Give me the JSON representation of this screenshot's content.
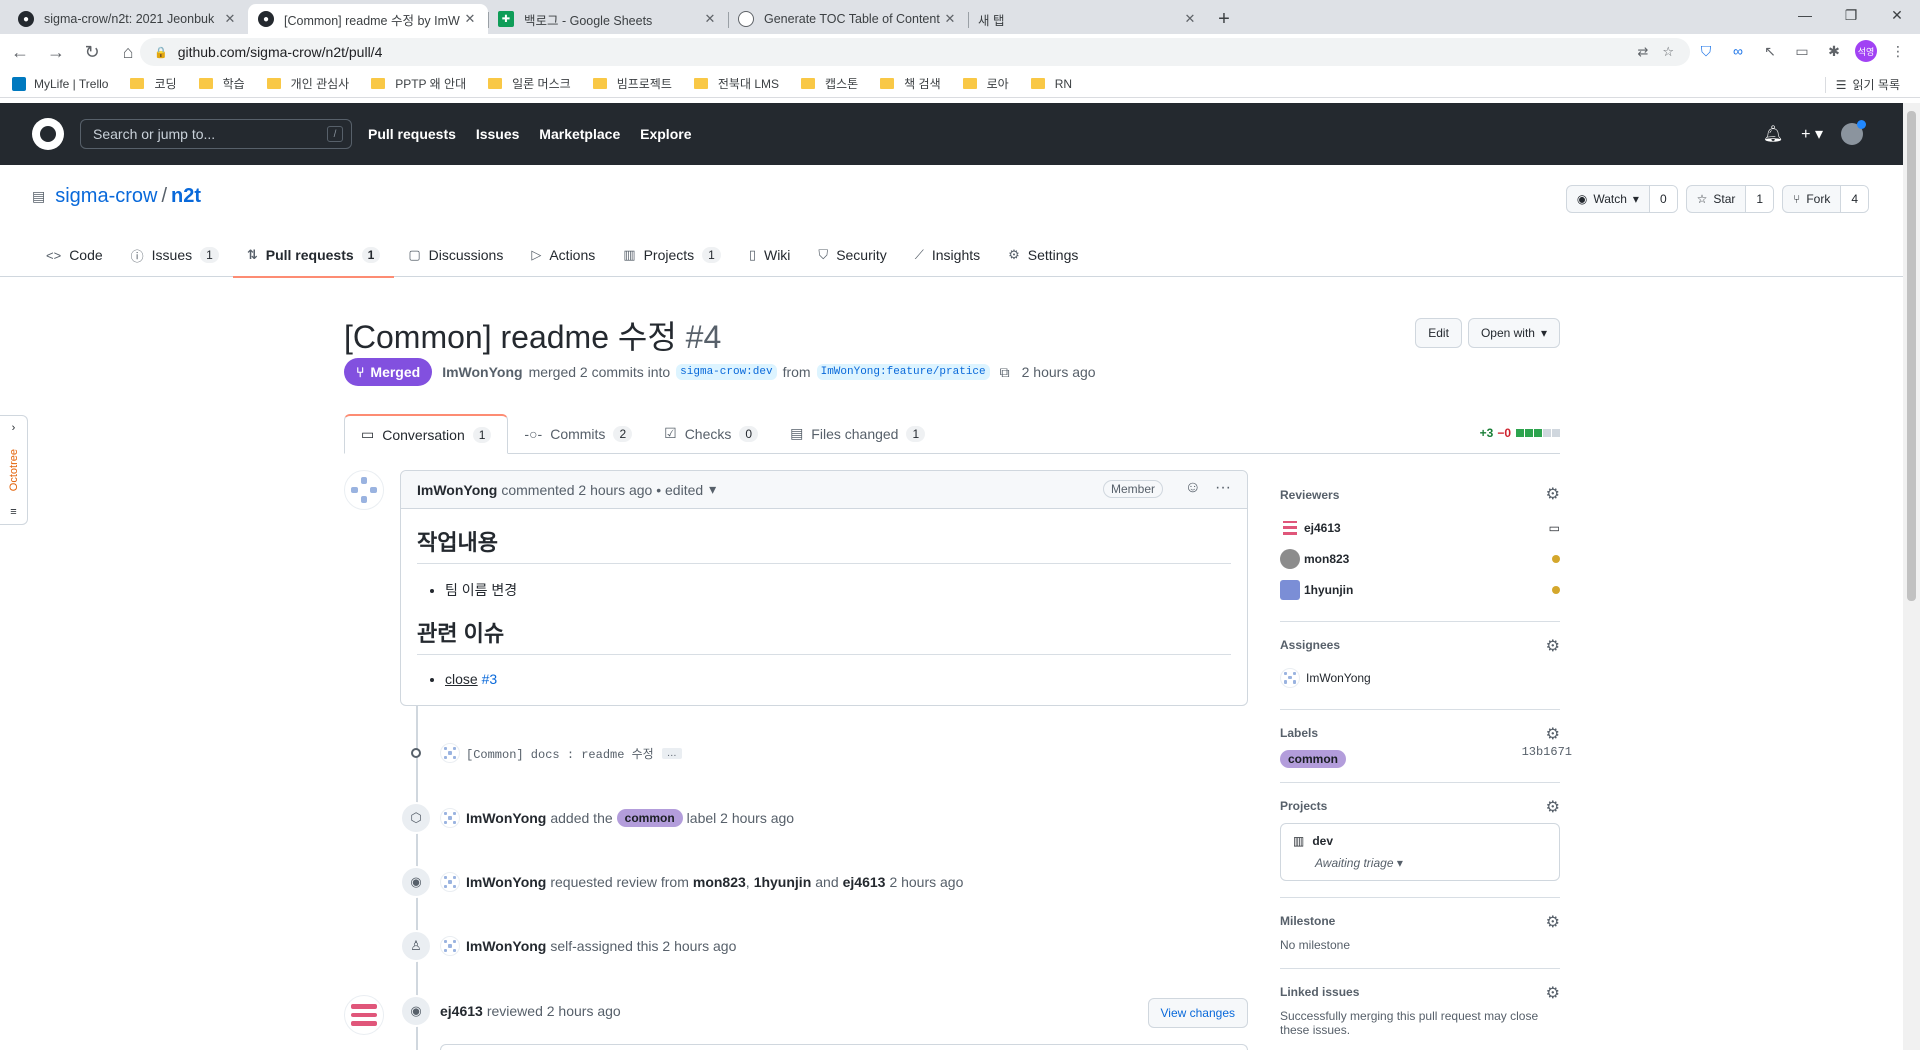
{
  "browser": {
    "tabs": [
      {
        "title": "sigma-crow/n2t: 2021 Jeonbuk",
        "icon": "github-icon",
        "active": false
      },
      {
        "title": "[Common] readme 수정 by ImW",
        "icon": "github-icon",
        "active": true
      },
      {
        "title": "백로그 - Google Sheets",
        "icon": "sheets-icon",
        "active": false
      },
      {
        "title": "Generate TOC Table of Content",
        "icon": "globe-icon",
        "active": false
      },
      {
        "title": "새 탭",
        "icon": "",
        "active": false
      }
    ],
    "url": "github.com/sigma-crow/n2t/pull/4",
    "profile_initials": "석영",
    "bookmarks": [
      {
        "label": "MyLife | Trello",
        "icon": "trello-icon"
      },
      {
        "label": "코딩",
        "icon": "folder-icon"
      },
      {
        "label": "학습",
        "icon": "folder-icon"
      },
      {
        "label": "개인 관심사",
        "icon": "folder-icon"
      },
      {
        "label": "PPTP 왜 안대",
        "icon": "folder-icon"
      },
      {
        "label": "일론 머스크",
        "icon": "folder-icon"
      },
      {
        "label": "빔프로젝트",
        "icon": "folder-icon"
      },
      {
        "label": "전북대 LMS",
        "icon": "folder-icon"
      },
      {
        "label": "캡스톤",
        "icon": "folder-icon"
      },
      {
        "label": "책 검색",
        "icon": "folder-icon"
      },
      {
        "label": "로아",
        "icon": "folder-icon"
      },
      {
        "label": "RN",
        "icon": "folder-icon"
      }
    ],
    "reading_list": "읽기 목록"
  },
  "github": {
    "search_placeholder": "Search or jump to...",
    "search_shortcut": "/",
    "nav": [
      "Pull requests",
      "Issues",
      "Marketplace",
      "Explore"
    ]
  },
  "repo": {
    "owner": "sigma-crow",
    "name": "n2t",
    "watch": {
      "label": "Watch",
      "count": "0"
    },
    "star": {
      "label": "Star",
      "count": "1"
    },
    "fork": {
      "label": "Fork",
      "count": "4"
    },
    "tabs": [
      {
        "label": "Code",
        "icon": "code-icon",
        "count": ""
      },
      {
        "label": "Issues",
        "icon": "issue-icon",
        "count": "1"
      },
      {
        "label": "Pull requests",
        "icon": "pull-request-icon",
        "count": "1"
      },
      {
        "label": "Discussions",
        "icon": "discussion-icon",
        "count": ""
      },
      {
        "label": "Actions",
        "icon": "play-icon",
        "count": ""
      },
      {
        "label": "Projects",
        "icon": "project-icon",
        "count": "1"
      },
      {
        "label": "Wiki",
        "icon": "book-icon",
        "count": ""
      },
      {
        "label": "Security",
        "icon": "shield-icon",
        "count": ""
      },
      {
        "label": "Insights",
        "icon": "graph-icon",
        "count": ""
      },
      {
        "label": "Settings",
        "icon": "gear-icon",
        "count": ""
      }
    ]
  },
  "pr": {
    "title": "[Common] readme 수정",
    "number": "#4",
    "edit_label": "Edit",
    "open_with_label": "Open with",
    "state": "Merged",
    "author": "ImWonYong",
    "merged_text": "merged 2 commits into",
    "base_branch": "sigma-crow:dev",
    "from_text": "from",
    "head_branch": "ImWonYong:feature/pratice",
    "time": "2 hours ago",
    "tabs": [
      {
        "label": "Conversation",
        "icon": "comment-icon",
        "count": "1"
      },
      {
        "label": "Commits",
        "icon": "commit-icon",
        "count": "2"
      },
      {
        "label": "Checks",
        "icon": "checklist-icon",
        "count": "0"
      },
      {
        "label": "Files changed",
        "icon": "file-diff-icon",
        "count": "1"
      }
    ],
    "additions": "+3",
    "deletions": "−0"
  },
  "comment": {
    "author": "ImWonYong",
    "meta": "commented 2 hours ago • edited",
    "badge": "Member",
    "heading1": "작업내용",
    "item1": "팀 이름 변경",
    "heading2": "관련 이슈",
    "item2_text": "close",
    "item2_link": "#3"
  },
  "timeline": {
    "commit_message": "[Common] docs : readme 수정",
    "commit_more": "…",
    "commit_sha": "13b1671",
    "label_event": {
      "actor": "ImWonYong",
      "pre": "added the",
      "label": "common",
      "post": "label 2 hours ago"
    },
    "review_request": {
      "actor": "ImWonYong",
      "text": "requested review from",
      "r1": "mon823",
      "sep": ",",
      "r2": "1hyunjin",
      "and": "and",
      "r3": "ej4613",
      "time": "2 hours ago"
    },
    "assign_event": {
      "actor": "ImWonYong",
      "text": "self-assigned this 2 hours ago"
    },
    "review_event": {
      "actor": "ej4613",
      "text": "reviewed 2 hours ago",
      "button": "View changes"
    }
  },
  "sidebar": {
    "reviewers_title": "Reviewers",
    "reviewers": [
      "ej4613",
      "mon823",
      "1hyunjin"
    ],
    "assignees_title": "Assignees",
    "assignee": "ImWonYong",
    "labels_title": "Labels",
    "label": "common",
    "projects_title": "Projects",
    "project_name": "dev",
    "project_status": "Awaiting triage",
    "milestone_title": "Milestone",
    "milestone": "No milestone",
    "linked_title": "Linked issues",
    "linked_text": "Successfully merging this pull request may close these issues."
  },
  "octotree": {
    "label": "Octotree"
  },
  "colors": {
    "merged": "#8250df",
    "label_common": "#b39ddb",
    "accent_tab": "#fd8c73",
    "link": "#0969da"
  }
}
